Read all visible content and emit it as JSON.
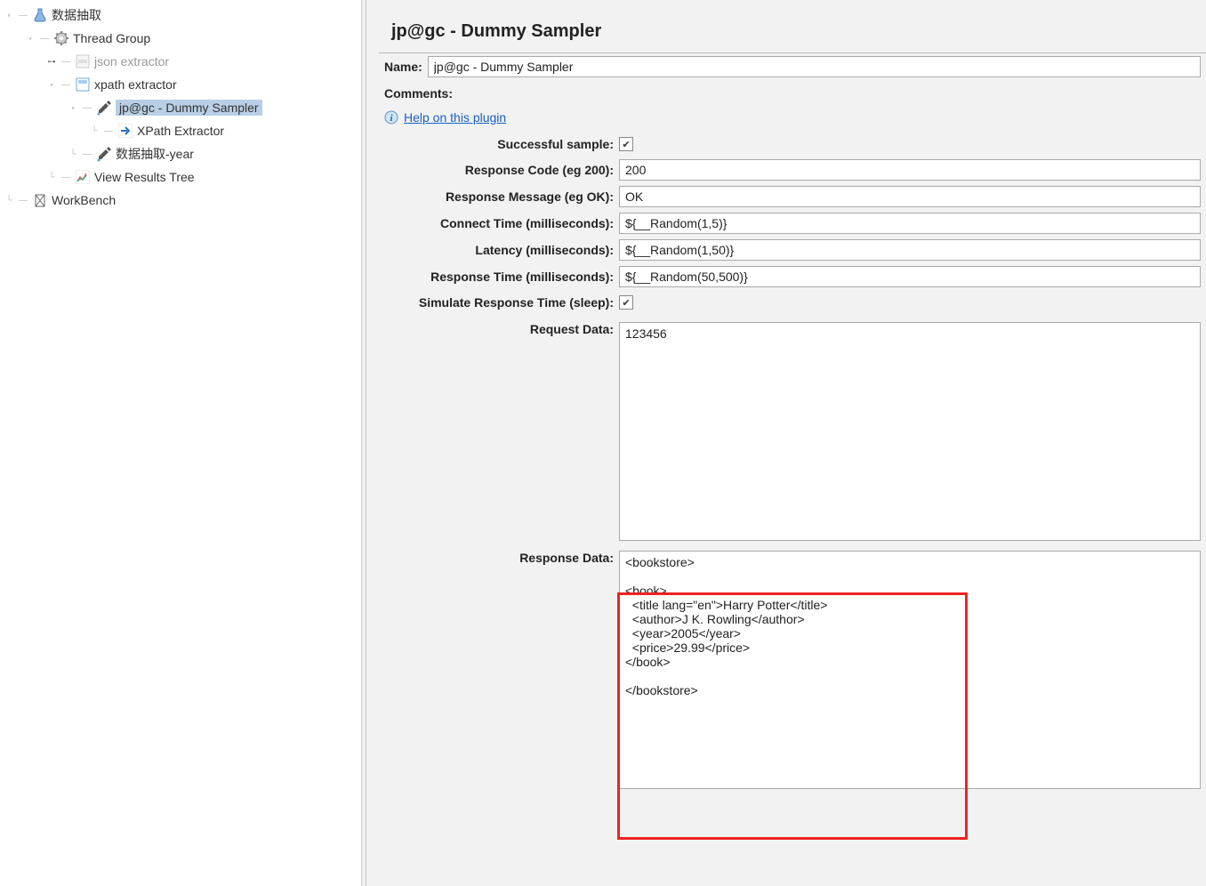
{
  "tree": {
    "root": "数据抽取",
    "thread_group": "Thread Group",
    "json_extractor": "json extractor",
    "xpath_extractor": "xpath extractor",
    "dummy_sampler": "jp@gc - Dummy Sampler",
    "xpath_extractor_child": "XPath Extractor",
    "year_sampler": "数据抽取-year",
    "view_results": "View Results Tree",
    "workbench": "WorkBench"
  },
  "panel": {
    "title": "jp@gc - Dummy Sampler",
    "name_label": "Name:",
    "name_value": "jp@gc - Dummy Sampler",
    "comments_label": "Comments:",
    "help_link": "Help on this plugin",
    "successful_label": "Successful sample:",
    "resp_code_label": "Response Code (eg 200):",
    "resp_code_value": "200",
    "resp_msg_label": "Response Message (eg OK):",
    "resp_msg_value": "OK",
    "connect_time_label": "Connect Time (milliseconds):",
    "connect_time_value": "${__Random(1,5)}",
    "latency_label": "Latency (milliseconds):",
    "latency_value": "${__Random(1,50)}",
    "resp_time_label": "Response Time (milliseconds):",
    "resp_time_value": "${__Random(50,500)}",
    "simulate_label": "Simulate Response Time (sleep):",
    "req_data_label": "Request Data:",
    "req_data_value": "123456",
    "resp_data_label": "Response Data:",
    "resp_data_value": "<bookstore>\n\n<book>\n  <title lang=\"en\">Harry Potter</title>\n  <author>J K. Rowling</author>\n  <year>2005</year>\n  <price>29.99</price>\n</book>\n\n</bookstore>"
  }
}
